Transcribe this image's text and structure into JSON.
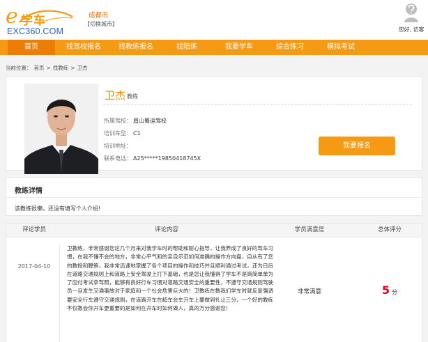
{
  "header": {
    "logo_text": "学车",
    "logo_url": "EXC360.COM",
    "city": "成都市",
    "switch_city": "【切换城市】",
    "greeting": "您好, 访客"
  },
  "nav": {
    "items": [
      {
        "label": "首页",
        "active": true
      },
      {
        "label": "找驾校报名",
        "active": false
      },
      {
        "label": "找教练报名",
        "active": false
      },
      {
        "label": "找陪练",
        "active": false
      },
      {
        "label": "我要学车",
        "active": false
      },
      {
        "label": "综合练习",
        "active": false
      },
      {
        "label": "模拟考试",
        "active": false
      }
    ]
  },
  "breadcrumb": {
    "prefix": "当前位置：",
    "items": [
      "首页",
      ">",
      "找教练",
      ">",
      "卫杰"
    ]
  },
  "coach": {
    "name": "卫杰",
    "role": "教练",
    "school_label": "所属驾校：",
    "school": "眉山蜀运驾校",
    "car_label": "培训车型：",
    "car": "C1",
    "address_label": "培训地址：",
    "address": "",
    "phone_label": "联系电话：",
    "phone": "A25*****19850418745X",
    "signup_label": "我要报名"
  },
  "detail": {
    "title": "教练详情",
    "text": "该教练很懒，还没有填写个人介绍!"
  },
  "reviews": {
    "columns": [
      "评论学员",
      "评论内容",
      "学员满意度",
      "总体评分"
    ],
    "rows": [
      {
        "date": "2017-04-10",
        "content": "卫教练，非常感谢您这几个月来对我学车时的帮助和耐心指导，让我养成了良好的驾车习惯，在我不懂不会的地方，非常心平气和的亲自示范如何准确的操作方向盘，自从有了您的教授和鞭策，我非常迅速地掌握了各个项目的操作和技巧并且顺利通过考试，还为日后在道路交通规则上和道路上安全驾驶上打下基础，也是您让我懂得了学车不是简简单单为了应付考试拿驾照，能够有良好行车习惯对道路交通安全的重要性，不遵守交通规则驾驶员一旦发生交通事故对于家庭和一个社会危害巨大的！卫教练在教我们学车时就反复强调要安全行车遵守交通规则，在道路开车在超车会车开车上要做到礼让三分，一个好的教练不仅教会你开车更重要的是如何在开车时如何做人，真的万分感谢您！",
        "satisfaction": "非常满意",
        "score": "5",
        "score_unit": "分"
      }
    ]
  }
}
